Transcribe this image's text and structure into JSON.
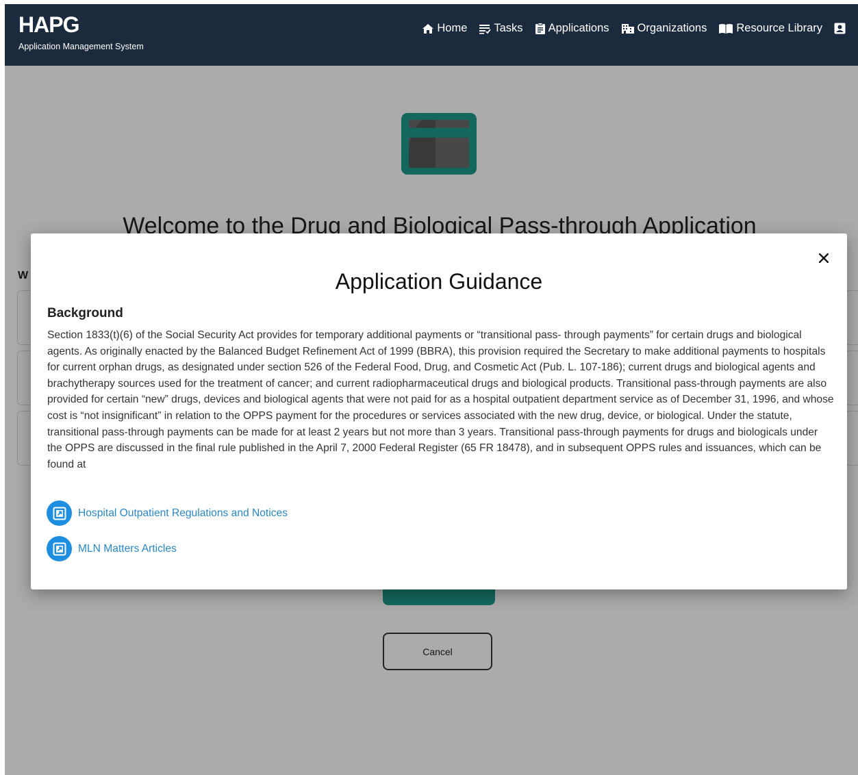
{
  "header": {
    "brand": "HAPG",
    "subtitle": "Application Management System",
    "nav": {
      "home": "Home",
      "tasks": "Tasks",
      "applications": "Applications",
      "organizations": "Organizations",
      "resource_library": "Resource Library"
    }
  },
  "page": {
    "welcome": "Welcome to the Drug and Biological Pass-through Application",
    "left_label": "W",
    "cancel": "Cancel"
  },
  "modal": {
    "title": "Application Guidance",
    "heading": "Background",
    "body": "Section 1833(t)(6) of the Social Security Act provides for temporary additional payments or “transitional pass- through payments” for certain drugs and biological agents. As originally enacted by the Balanced Budget Refinement Act of 1999 (BBRA), this provision required the Secretary to make additional payments to hospitals for current orphan drugs, as designated under section 526 of the Federal Food, Drug, and Cosmetic Act (Pub. L. 107-186); current drugs and biological agents and brachytherapy sources used for the treatment of cancer; and current radiopharmaceutical drugs and biological products. Transitional pass-through payments are also provided for certain “new” drugs, devices and biological agents that were not paid for as a hospital outpatient department service as of December 31, 1996, and whose cost is “not insignificant” in relation to the OPPS payment for the procedures or services associated with the new drug, device, or biological. Under the statute, transitional pass-through payments can be made for at least 2 years but not more than 3 years. Transitional pass-through payments for drugs and biologicals under the OPPS are discussed in the final rule published in the April 7, 2000 Federal Register (65 FR 18478), and in subsequent OPPS rules and issuances, which can be found at",
    "links": [
      "Hospital Outpatient Regulations and Notices",
      "MLN Matters Articles"
    ]
  },
  "colors": {
    "header_bg": "#1c2a3e",
    "accent_teal": "#1f9a8a",
    "link_blue": "#2a87c8",
    "link_icon_bg": "#1e8fe0"
  },
  "icons": [
    "home-icon",
    "tasks-icon",
    "clipboard-icon",
    "building-icon",
    "book-icon",
    "user-icon",
    "close-icon",
    "external-link-icon",
    "card-icon"
  ]
}
